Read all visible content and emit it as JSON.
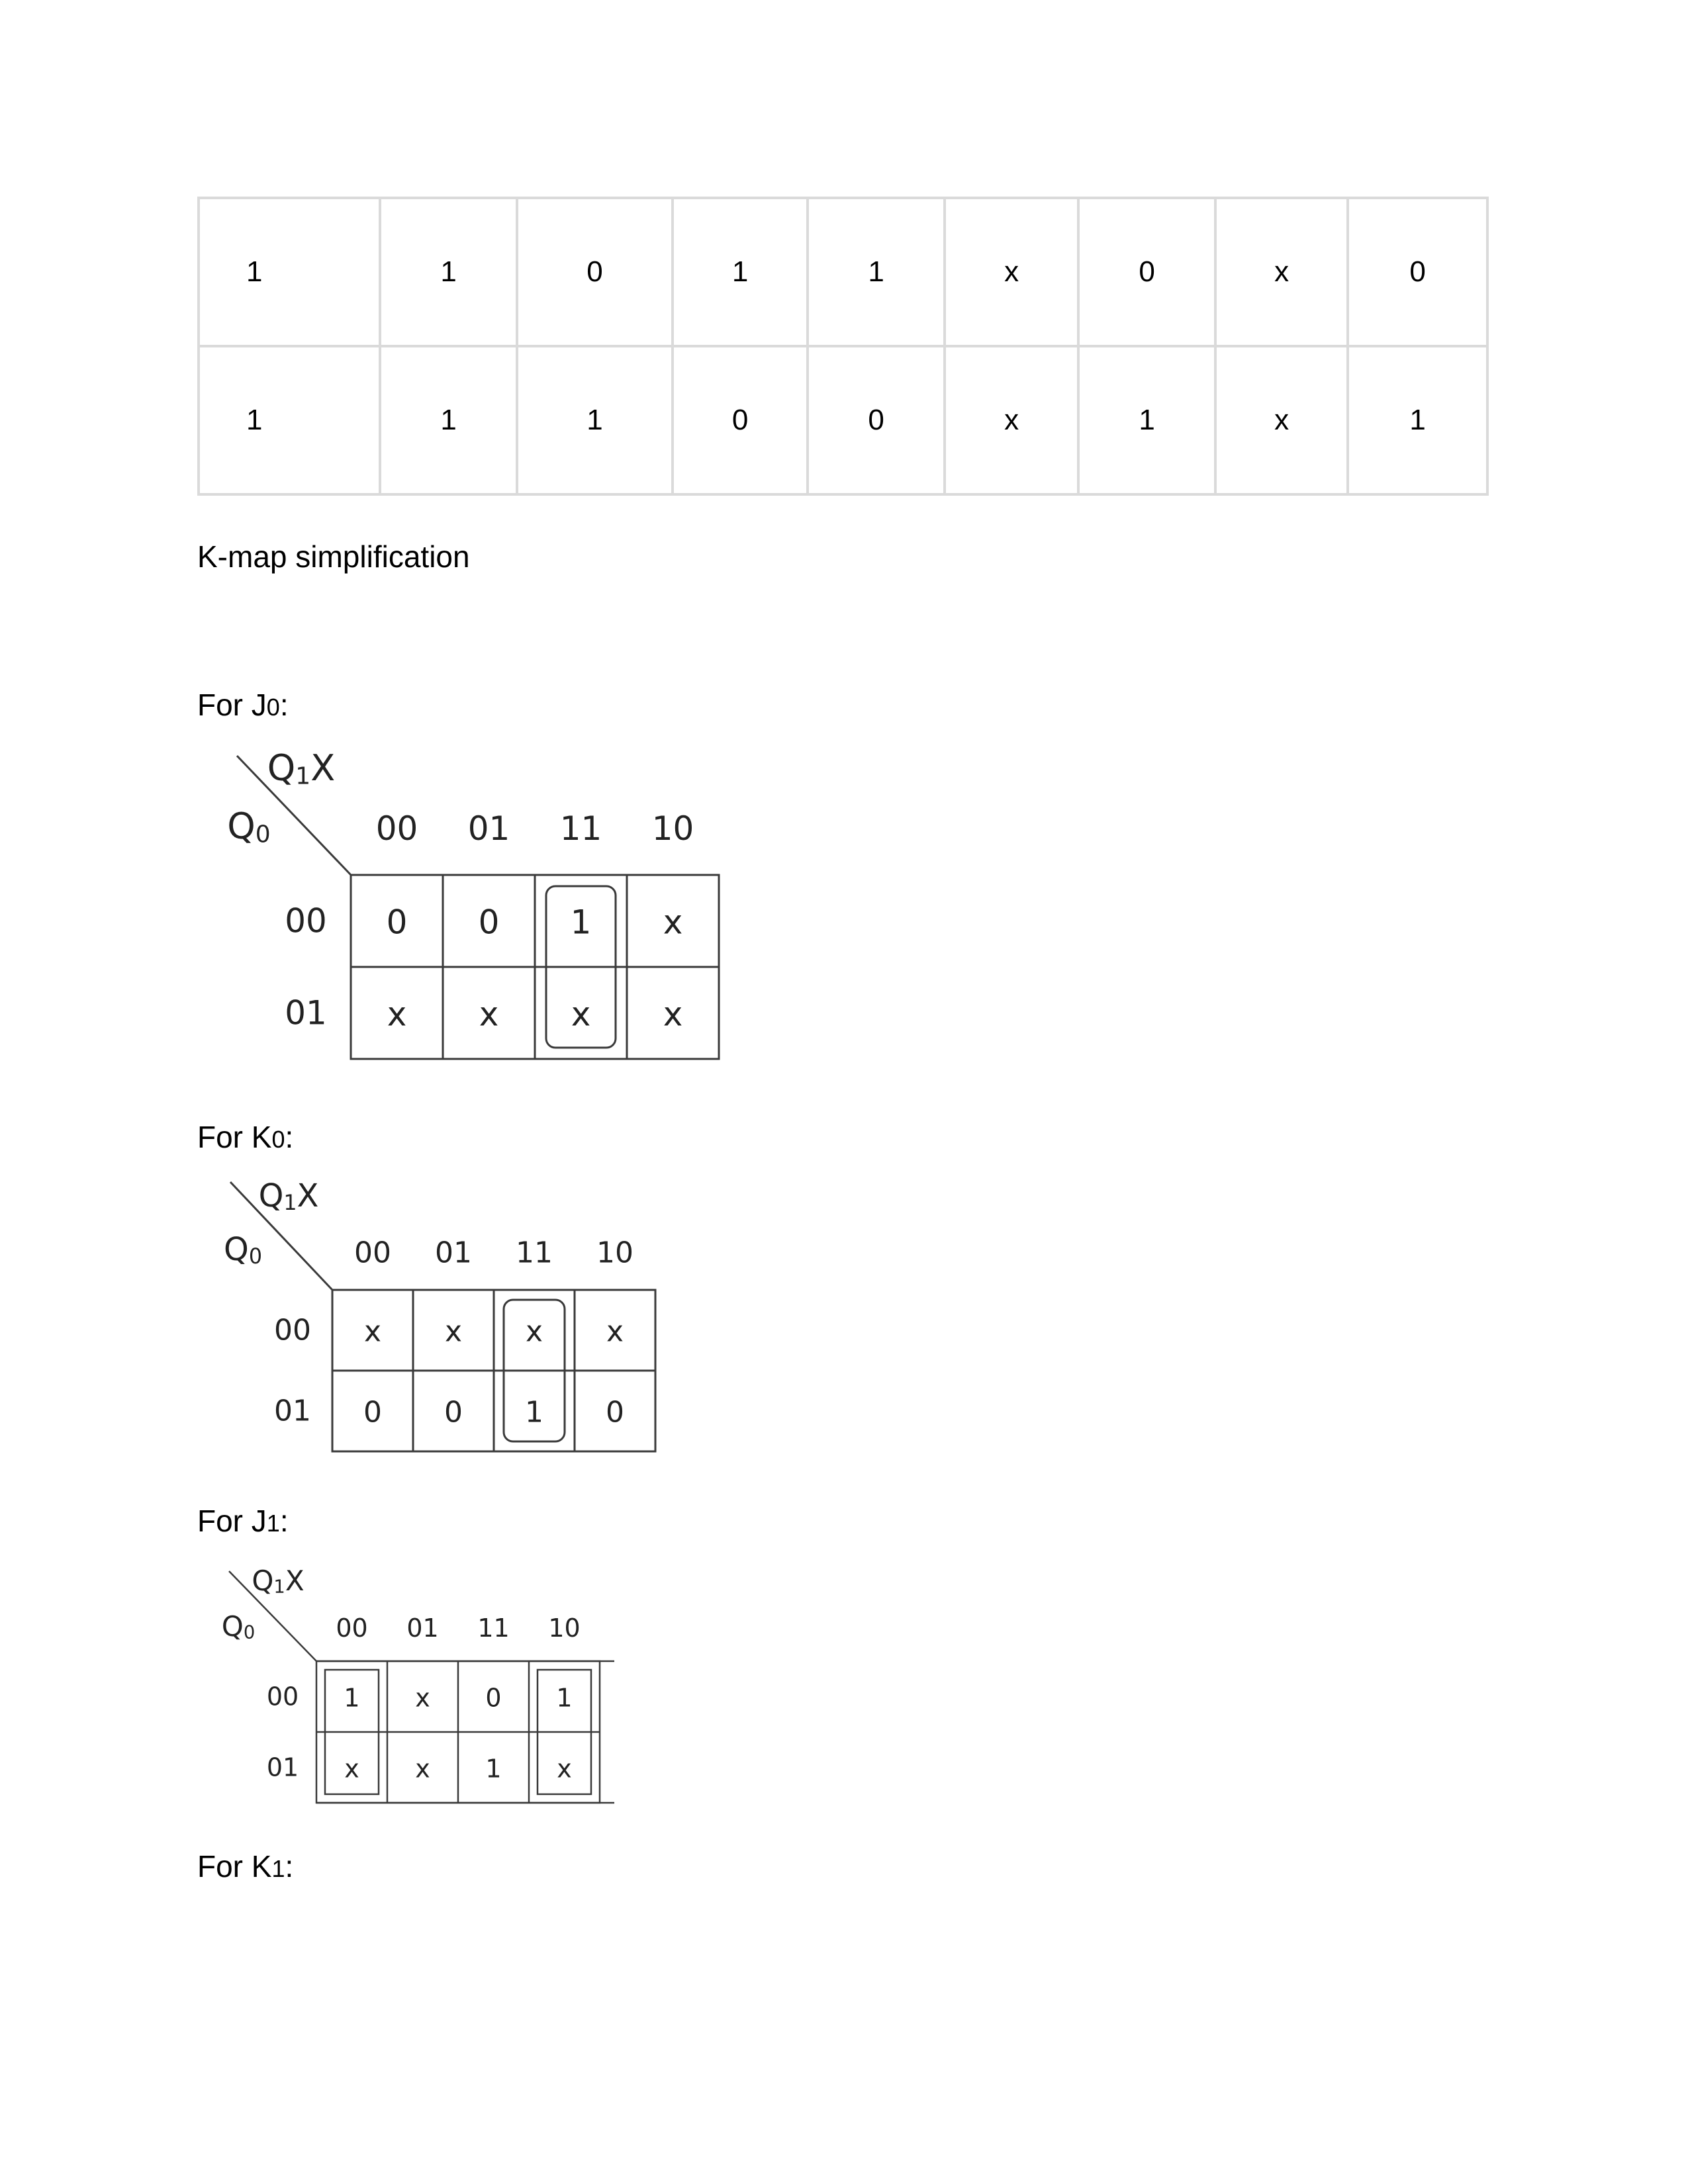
{
  "truth_table": {
    "rows": [
      [
        "1",
        "1",
        "0",
        "1",
        "1",
        "x",
        "0",
        "x",
        "0"
      ],
      [
        "1",
        "1",
        "1",
        "0",
        "0",
        "x",
        "1",
        "x",
        "1"
      ]
    ]
  },
  "section_title": "K-map simplification",
  "headings": {
    "j0": {
      "prefix": "For J",
      "sub": "0",
      "suffix": ":"
    },
    "k0": {
      "prefix": "For K",
      "sub": "0",
      "suffix": ":"
    },
    "j1": {
      "prefix": "For J",
      "sub": "1",
      "suffix": ":"
    },
    "k1": {
      "prefix": "For K",
      "sub": "1",
      "suffix": ":"
    }
  },
  "kmaps": [
    {
      "id": "j0",
      "var_top": "Q",
      "var_top_sub": "1",
      "var_top_suffix": "X",
      "var_side": "Q",
      "var_side_sub": "0",
      "col_labels": [
        "00",
        "01",
        "11",
        "10"
      ],
      "row_labels": [
        "00",
        "01"
      ],
      "cells": [
        [
          "0",
          "0",
          "1",
          "x"
        ],
        [
          "x",
          "x",
          "x",
          "x"
        ]
      ],
      "groups": [
        {
          "col": 2,
          "row_start": 0,
          "row_end": 1,
          "style": "rounded"
        }
      ]
    },
    {
      "id": "k0",
      "var_top": "Q",
      "var_top_sub": "1",
      "var_top_suffix": "X",
      "var_side": "Q",
      "var_side_sub": "0",
      "col_labels": [
        "00",
        "01",
        "11",
        "10"
      ],
      "row_labels": [
        "00",
        "01"
      ],
      "cells": [
        [
          "x",
          "x",
          "x",
          "x"
        ],
        [
          "0",
          "0",
          "1",
          "0"
        ]
      ],
      "groups": [
        {
          "col": 2,
          "row_start": 0,
          "row_end": 1,
          "style": "rounded"
        }
      ]
    },
    {
      "id": "j1",
      "var_top": "Q",
      "var_top_sub": "1",
      "var_top_suffix": "X",
      "var_side": "Q",
      "var_side_sub": "0",
      "col_labels": [
        "00",
        "01",
        "11",
        "10"
      ],
      "row_labels": [
        "00",
        "01"
      ],
      "cells": [
        [
          "1",
          "x",
          "0",
          "1"
        ],
        [
          "x",
          "x",
          "1",
          "x"
        ]
      ],
      "groups": [
        {
          "col": 0,
          "row_start": 0,
          "row_end": 1,
          "style": "square"
        },
        {
          "col": 3,
          "row_start": 0,
          "row_end": 1,
          "style": "square"
        }
      ]
    }
  ]
}
